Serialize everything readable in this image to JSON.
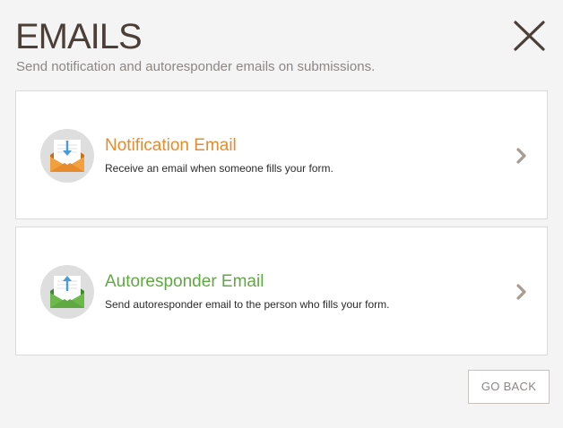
{
  "header": {
    "title": "EMAILS",
    "subtitle": "Send notification and autoresponder emails on submissions."
  },
  "cards": [
    {
      "title": "Notification Email",
      "description": "Receive an email when someone fills your form.",
      "icon": "envelope-download-icon",
      "accent": "#e88a2e"
    },
    {
      "title": "Autoresponder Email",
      "description": "Send autoresponder email to the person who fills your form.",
      "icon": "envelope-upload-icon",
      "accent": "#5fa943"
    }
  ],
  "footer": {
    "go_back_label": "GO BACK"
  },
  "colors": {
    "background": "#f5f4f4",
    "title": "#4b3f38",
    "subtitle": "#8d8683",
    "notification_accent": "#e88a2e",
    "autoresponder_accent": "#5fa943",
    "arrow_blue": "#4a9bd6"
  }
}
